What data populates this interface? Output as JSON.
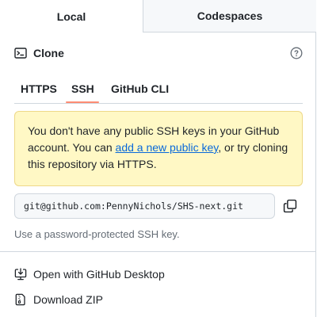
{
  "tabs": {
    "local": "Local",
    "codespaces": "Codespaces"
  },
  "clone": {
    "title": "Clone",
    "help_icon": "question-circle-icon",
    "terminal_icon": "terminal-icon"
  },
  "protocols": {
    "https": "HTTPS",
    "ssh": "SSH",
    "cli": "GitHub CLI",
    "selected": "SSH"
  },
  "warning": {
    "text_before": "You don't have any public SSH keys in your GitHub account. You can ",
    "link_text": "add a new public key",
    "text_after": ", or try cloning this repository via HTTPS."
  },
  "url": {
    "value": "git@github.com:PennyNichols/SHS-next.git",
    "copy_icon": "copy-icon"
  },
  "hint": "Use a password-protected SSH key.",
  "actions": {
    "desktop": "Open with GitHub Desktop",
    "zip": "Download ZIP"
  },
  "colors": {
    "accent_underline": "#fd8c73",
    "warning_bg": "#fff8c5",
    "link": "#0969da",
    "muted": "#656d76"
  }
}
